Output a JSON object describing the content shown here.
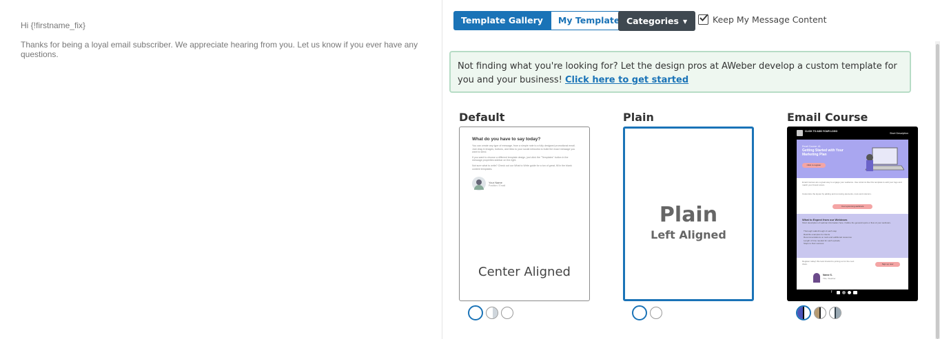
{
  "email": {
    "greeting": "Hi {!firstname_fix}",
    "body": "Thanks for being a loyal email subscriber. We appreciate hearing from you. Let us know if you ever have any questions."
  },
  "toolbar": {
    "tab_gallery": "Template Gallery",
    "tab_mine": "My Templates",
    "categories": "Categories",
    "keep_content": "Keep My Message Content"
  },
  "notice": {
    "text": "Not finding what you're looking for? Let the design pros at AWeber develop a custom template for you and your business! ",
    "link": "Click here to get started"
  },
  "templates": {
    "default": {
      "name": "Default",
      "heading": "What do you have to say today?",
      "p1": "You can create any type of message, from a simple note to a fully designed promotional email. Just drag in images, buttons, and links to your social networks to build the exact message you want to send.",
      "p2": "If you want to choose a different template design, just click the \"Templates\" button in the message properties sidebar on the right.",
      "p3": "Not sure what to write? Check out our What to Write guide for a ton of great, fill in the blank content templates.",
      "sig_name": "Your Name",
      "sig_role": "Position / Email",
      "caption": "Center Aligned"
    },
    "plain": {
      "name": "Plain",
      "big": "Plain",
      "sub": "Left Aligned"
    },
    "course": {
      "name": "Email Course",
      "logo": "CLICK TO ADD YOUR LOGO",
      "short": "Short Description",
      "hero_kicker": "Email Course: #1",
      "hero_title": "Getting Started with Your Marketing Plan",
      "hero_btn": "Click to register",
      "intro": "Email courses are a great way to engage your audience. Use columns like this template to add your logo and match your brand colors.",
      "intro2": "Customize the layout by adding and removing elements, rows and columns.",
      "mid_btn": "Your upcoming webinars",
      "list_title": "What to Expect from our Webinars",
      "list_intro": "Short description of webinar information here. Outline the general topics or flow of your webinars.",
      "list_items": [
        "Thorough walk-through of each step",
        "Real life examples for clients",
        "Recommendations on tools and additional resources",
        "Length of time needed for each episode",
        "Steps to their success"
      ],
      "reg_text": "Register today! We look forward to joining us for the next class.",
      "reg_btn": "Sign up now",
      "sig_name": "Name S.",
      "sig_role": "Title, Weather"
    }
  },
  "colors": {
    "accent": "#1a73b7",
    "dark_button": "#3f4850",
    "notice_bg": "#eef7f0",
    "notice_border": "#b6dcc5",
    "course_purple": "#a9a6f0",
    "course_pink": "#f4a5a5"
  }
}
